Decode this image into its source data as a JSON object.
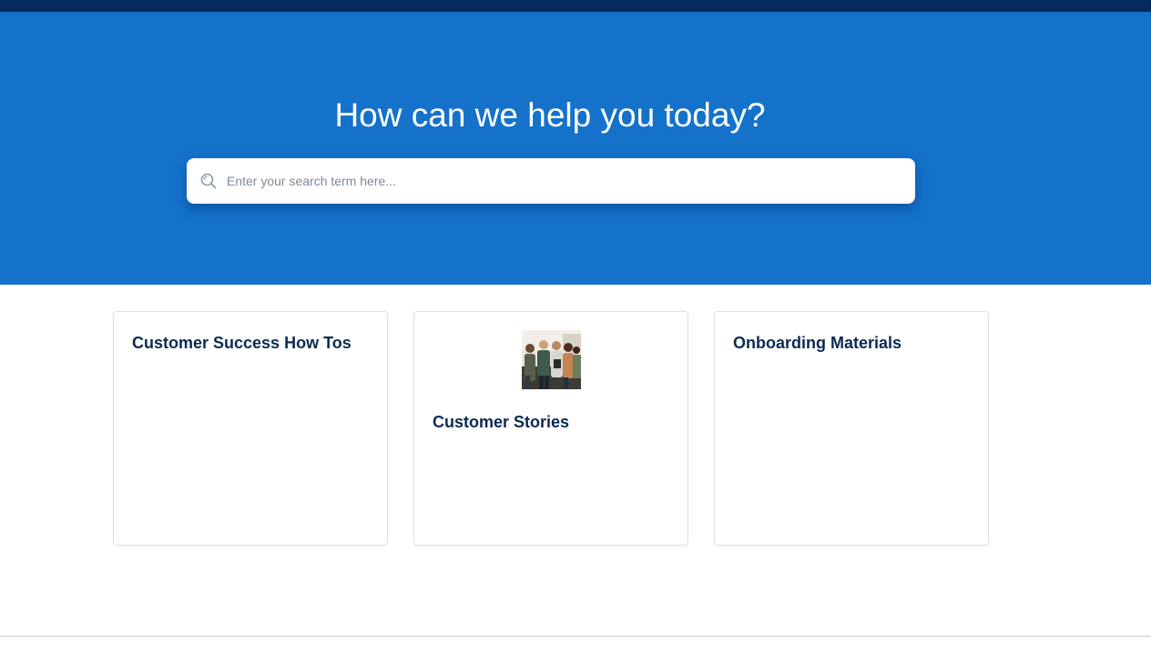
{
  "hero": {
    "title": "How can we help you today?",
    "search_placeholder": "Enter your search term here..."
  },
  "categories": [
    {
      "title": "Customer Success How Tos",
      "has_image": false
    },
    {
      "title": "Customer Stories",
      "has_image": true,
      "image": "group-of-people-photo"
    },
    {
      "title": "Onboarding Materials",
      "has_image": false
    }
  ],
  "colors": {
    "topbar": "#062a5e",
    "hero_background": "#1472cb",
    "card_title": "#0b2a52",
    "card_border": "#dcdfe4"
  },
  "icons": {
    "search": "search-icon"
  }
}
